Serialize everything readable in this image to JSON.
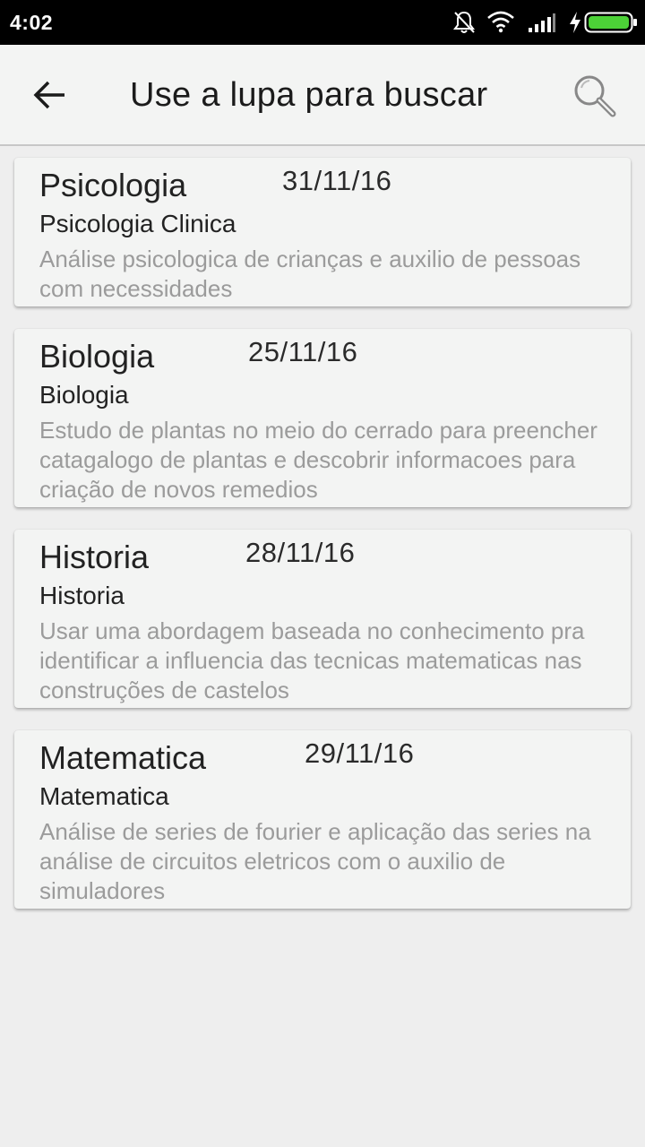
{
  "status_bar": {
    "time": "4:02",
    "icons": [
      "alarm-off-icon",
      "wifi-icon",
      "signal-icon",
      "charging-icon",
      "battery-icon"
    ],
    "battery_color": "#4cd137"
  },
  "app_bar": {
    "title": "Use a lupa para buscar",
    "back_icon": "arrow-left-icon",
    "search_icon": "search-icon"
  },
  "cards": [
    {
      "title": "Psicologia",
      "date": "31/11/16",
      "subtitle": "Psicologia Clinica",
      "description": "Análise psicologica de crianças e auxilio de pessoas com necessidades"
    },
    {
      "title": "Biologia",
      "date": "25/11/16",
      "subtitle": "Biologia",
      "description": "Estudo de plantas no meio do cerrado para preencher catagalogo de plantas e descobrir informacoes para criação de novos remedios"
    },
    {
      "title": "Historia",
      "date": "28/11/16",
      "subtitle": "Historia",
      "description": "Usar uma abordagem baseada no conhecimento pra identificar a influencia das tecnicas matematicas nas construções de castelos"
    },
    {
      "title": "Matematica",
      "date": "29/11/16",
      "subtitle": "Matematica",
      "description": "Análise de series de fourier e aplicação das series na análise de circuitos eletricos com o auxilio de simuladores"
    }
  ]
}
